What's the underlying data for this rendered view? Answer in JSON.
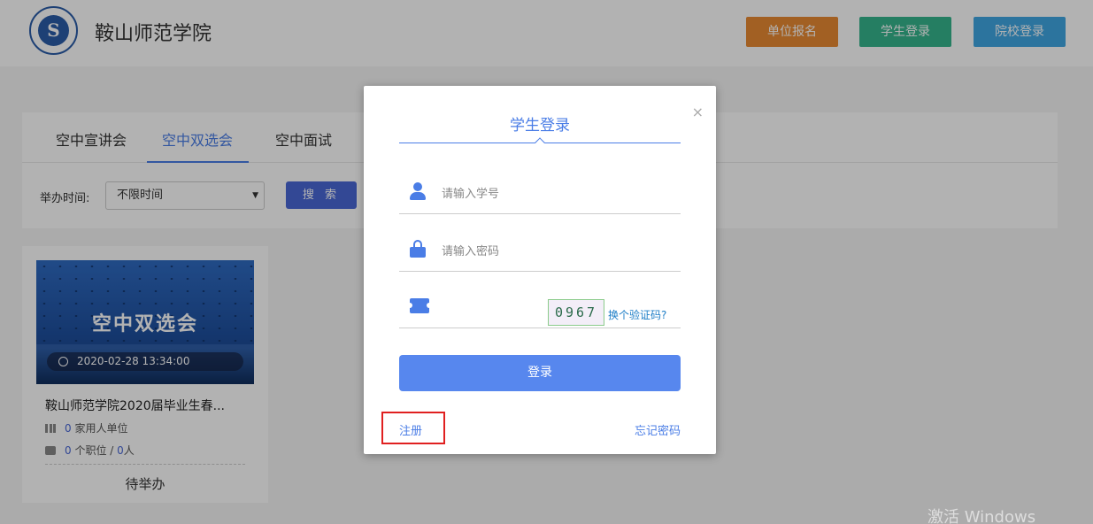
{
  "header": {
    "logo_text": "S",
    "school_name": "鞍山师范学院",
    "buttons": [
      "单位报名",
      "学生登录",
      "院校登录"
    ],
    "button_colors": [
      "#e88a33",
      "#36b58d",
      "#3fa6e3"
    ]
  },
  "tabs": [
    {
      "label": "空中宣讲会",
      "active": false
    },
    {
      "label": "空中双选会",
      "active": true
    },
    {
      "label": "空中面试",
      "active": false
    }
  ],
  "filter": {
    "label": "举办时间:",
    "select_value": "不限时间",
    "search_label": "搜 索"
  },
  "card": {
    "image_title": "空中双选会",
    "date": "2020-02-28 13:34:00",
    "title": "鞍山师范学院2020届毕业生春...",
    "employers_count": "0",
    "employers_label": "家用人单位",
    "positions_count": "0",
    "positions_label": "个职位 /",
    "people_count": "0",
    "people_label": "人",
    "status": "待举办"
  },
  "modal": {
    "title": "学生登录",
    "close": "×",
    "student_id_placeholder": "请输入学号",
    "password_placeholder": "请输入密码",
    "captcha_value": "0967",
    "change_captcha": "换个验证码?",
    "login_label": "登录",
    "register_label": "注册",
    "forgot_label": "忘记密码"
  },
  "watermark": "激活 Windows",
  "accent_color": "#4a7de6"
}
